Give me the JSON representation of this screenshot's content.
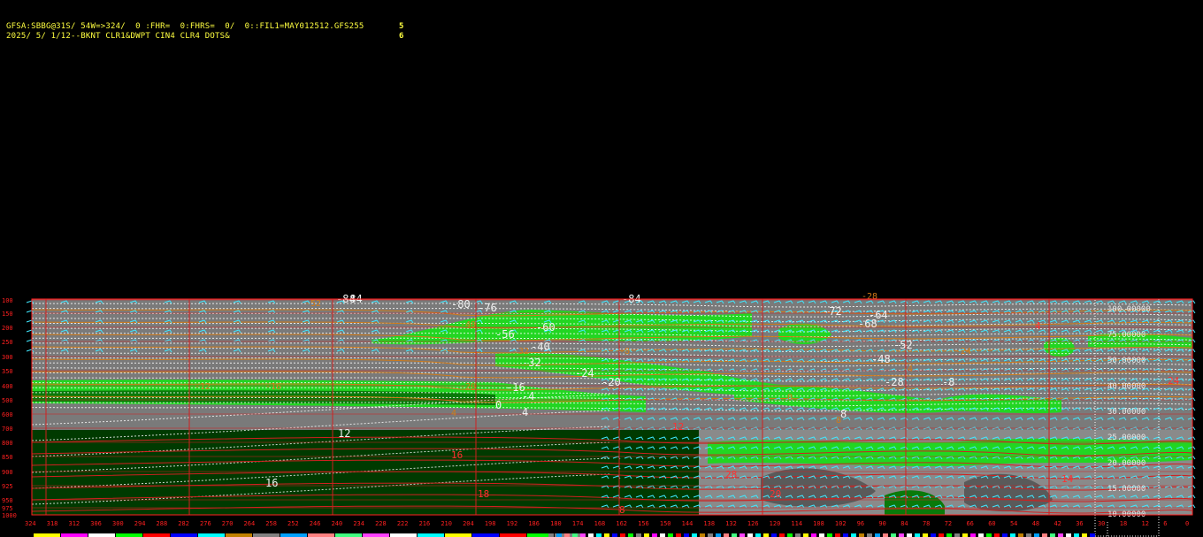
{
  "header": {
    "line1": "GFSA:SBBG@31S/ 54W=>324/  0 :FHR=  0:FHRS=  0/  0::FIL1=MAY012512.GFS255",
    "line1_num": "5",
    "line2": "2025/ 5/ 1/12--BKNT CLR1&DWPT CIN4 CLR4 DOTS&",
    "line2_num": "6"
  },
  "colors": {
    "background": "#000000",
    "header_text": "#ffff40",
    "axis": "#ff2020",
    "grid": "#d02020",
    "gray_fill": "#7a7a7a",
    "dark_green": "#003a00",
    "bright_green": "#22d622",
    "mid_green": "#0a7a0a",
    "dots": "#ffffff",
    "wind_barbs": "#40e8ff",
    "orange_contours": "#d07a18",
    "right_labels": "#e8e8e8"
  },
  "chart_data": {
    "type": "heatmap",
    "title": "",
    "xlabel": "",
    "ylabel": "",
    "y_ticks": [
      "100",
      "150",
      "200",
      "250",
      "300",
      "350",
      "400",
      "500",
      "600",
      "700",
      "800",
      "850",
      "900",
      "925",
      "950",
      "975",
      "1000"
    ],
    "x_ticks": [
      "324",
      "318",
      "312",
      "306",
      "300",
      "294",
      "288",
      "282",
      "276",
      "270",
      "264",
      "258",
      "252",
      "246",
      "240",
      "234",
      "228",
      "222",
      "216",
      "210",
      "204",
      "198",
      "192",
      "186",
      "180",
      "174",
      "168",
      "162",
      "156",
      "150",
      "144",
      "138",
      "132",
      "126",
      "120",
      "114",
      "108",
      "102",
      "96",
      "90",
      "84",
      "78",
      "72",
      "66",
      "60",
      "54",
      "48",
      "42",
      "36",
      "30",
      "18",
      "12",
      "6",
      "0"
    ],
    "right_labels": [
      "100.00000",
      "75.00000",
      "50.00000",
      "40.00000",
      "30.00000",
      "25.00000",
      "20.00000",
      "15.00000",
      "10.00000"
    ],
    "white_labels": [
      "-84",
      "-84",
      "-84",
      "-80",
      "-76",
      "-72",
      "-68",
      "-64",
      "-60",
      "-56",
      "-52",
      "-48",
      "-40",
      "-32",
      "-28",
      "-24",
      "-20",
      "-16",
      "-8",
      "-4",
      "0",
      "4",
      "8",
      "12",
      "16"
    ],
    "red_labels": [
      "28",
      "24",
      "20",
      "18",
      "16",
      "14",
      "12",
      "8",
      "4"
    ],
    "orange_labels": [
      "-52",
      "-40",
      "-32",
      "-28",
      "-24",
      "-20",
      "-16",
      "-12",
      "-8",
      "-4",
      "0",
      "4",
      "8"
    ]
  }
}
